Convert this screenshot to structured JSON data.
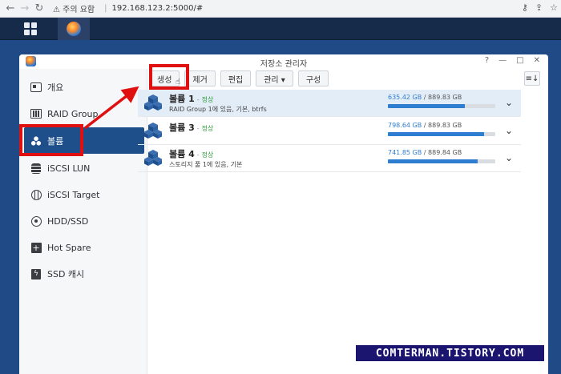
{
  "browser": {
    "warning": "⚠ 주의 요함",
    "url": "192.168.123.2:5000/#"
  },
  "window": {
    "title": "저장소 관리자",
    "controls": [
      "?",
      "—",
      "□",
      "✕"
    ]
  },
  "sidebar": {
    "items": [
      {
        "label": "개요",
        "icon": "overview-icon"
      },
      {
        "label": "RAID Group",
        "icon": "raid-group-icon"
      },
      {
        "label": "볼륨",
        "icon": "volume-icon"
      },
      {
        "label": "iSCSI LUN",
        "icon": "iscsi-lun-icon"
      },
      {
        "label": "iSCSI Target",
        "icon": "iscsi-target-icon"
      },
      {
        "label": "HDD/SSD",
        "icon": "hdd-ssd-icon"
      },
      {
        "label": "Hot Spare",
        "icon": "hot-spare-icon"
      },
      {
        "label": "SSD 캐시",
        "icon": "ssd-cache-icon"
      }
    ],
    "active_index": 2
  },
  "toolbar": {
    "create": "생성",
    "remove": "제거",
    "edit": "편집",
    "manage": "관리 ▾",
    "configure": "구성"
  },
  "volumes": [
    {
      "name": "볼륨 1",
      "dash": "-",
      "status": "정상",
      "desc": "RAID Group 1에 있음, 기본, btrfs",
      "used": "635.42 GB",
      "total": "/ 889.83 GB",
      "usage_fraction": 0.714
    },
    {
      "name": "볼륨 3",
      "dash": "-",
      "status": "정상",
      "desc": "",
      "used": "798.64 GB",
      "total": "/ 889.83 GB",
      "usage_fraction": 0.897
    },
    {
      "name": "볼륨 4",
      "dash": "-",
      "status": "정상",
      "desc": "스토리지 풀 1에 있음, 기본",
      "used": "741.85 GB",
      "total": "/ 889.84 GB",
      "usage_fraction": 0.834
    }
  ],
  "watermark": "COMTERMAN.TISTORY.COM",
  "colors": {
    "accent": "#2f7dd1",
    "active_sidebar": "#1e4f8a",
    "status_ok": "#2e9b3a",
    "highlight": "#e01010"
  }
}
